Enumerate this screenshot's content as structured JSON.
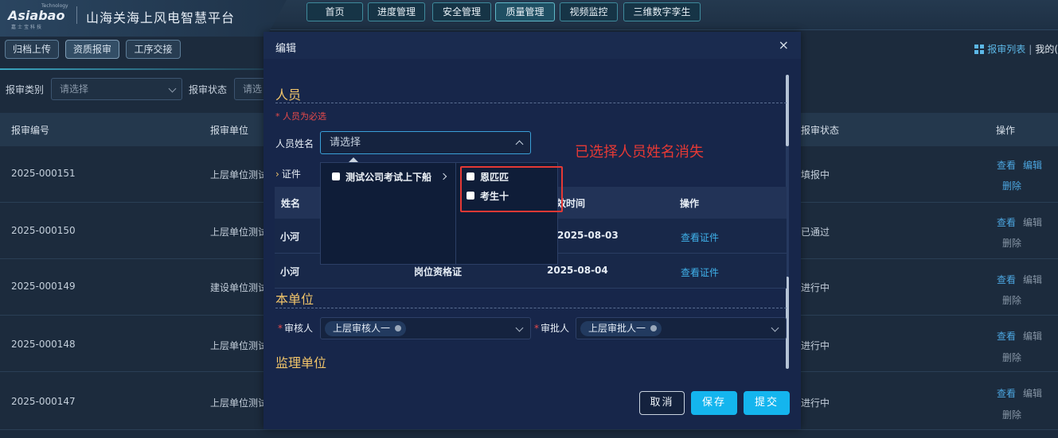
{
  "header": {
    "logo_text": "Asiabao",
    "logo_tech": "Technology",
    "logo_sub": "嘉士宝科技",
    "app_title": "山海关海上风电智慧平台",
    "nav": [
      {
        "label": "首页"
      },
      {
        "label": "进度管理"
      },
      {
        "label": "安全管理"
      },
      {
        "label": "质量管理"
      },
      {
        "label": "视频监控"
      },
      {
        "label": "三维数字孪生"
      }
    ]
  },
  "subnav": {
    "tabs": [
      {
        "label": "归档上传"
      },
      {
        "label": "资质报审"
      },
      {
        "label": "工序交接"
      }
    ],
    "report_list_link": "报审列表",
    "separator": "|",
    "my_link": "我的("
  },
  "filters": {
    "type_label": "报审类别",
    "type_placeholder": "请选择",
    "status_label": "报审状态",
    "status_placeholder": "请选"
  },
  "table": {
    "headers": {
      "id": "报审编号",
      "unit": "报审单位",
      "status": "报审状态",
      "ops": "操作"
    },
    "rows": [
      {
        "id": "2025-000151",
        "unit": "上层单位测试",
        "status": "填报中",
        "op1": "查看",
        "op2": "编辑",
        "op3": "删除"
      },
      {
        "id": "2025-000150",
        "unit": "上层单位测试",
        "status": "已通过",
        "op1": "查看",
        "op2": "编辑",
        "op3": "删除"
      },
      {
        "id": "2025-000149",
        "unit": "建设单位测试",
        "status": "进行中",
        "op1": "查看",
        "op2": "编辑",
        "op3": "删除"
      },
      {
        "id": "2025-000148",
        "unit": "上层单位测试",
        "status": "进行中",
        "op1": "查看",
        "op2": "编辑",
        "op3": "删除"
      },
      {
        "id": "2025-000147",
        "unit": "上层单位测试",
        "status": "进行中",
        "op1": "查看",
        "op2": "编辑",
        "op3": "删除"
      }
    ]
  },
  "modal": {
    "title": "编辑",
    "close": "×",
    "section_personnel": "人员",
    "required_note": "* 人员为必选",
    "person_label": "人员姓名",
    "person_placeholder": "请选择",
    "cert_label": "证件",
    "cert_bullet": "›",
    "cert_table": {
      "headers": {
        "name": "姓名",
        "time": "效时间",
        "ops": "操作"
      },
      "rows": [
        {
          "name": "小河",
          "cert": "",
          "time": "2025-08-03",
          "link": "查看证件"
        },
        {
          "name": "小河",
          "cert": "岗位资格证",
          "time": "2025-08-04",
          "link": "查看证件"
        }
      ]
    },
    "section_unit": "本单位",
    "reviewer_label": "审核人",
    "reviewer_tag": "上层审核人一",
    "approver_label": "审批人",
    "approver_tag": "上层审批人一",
    "section_supervision": "监理单位",
    "buttons": {
      "cancel": "取消",
      "save": "保存",
      "submit": "提交"
    }
  },
  "cascader": {
    "group": "测试公司考试上下船",
    "options": [
      {
        "label": "恩匹匹"
      },
      {
        "label": "考生十"
      }
    ]
  },
  "annotation": {
    "text": "已选择人员姓名消失",
    "color": "#e53935"
  }
}
